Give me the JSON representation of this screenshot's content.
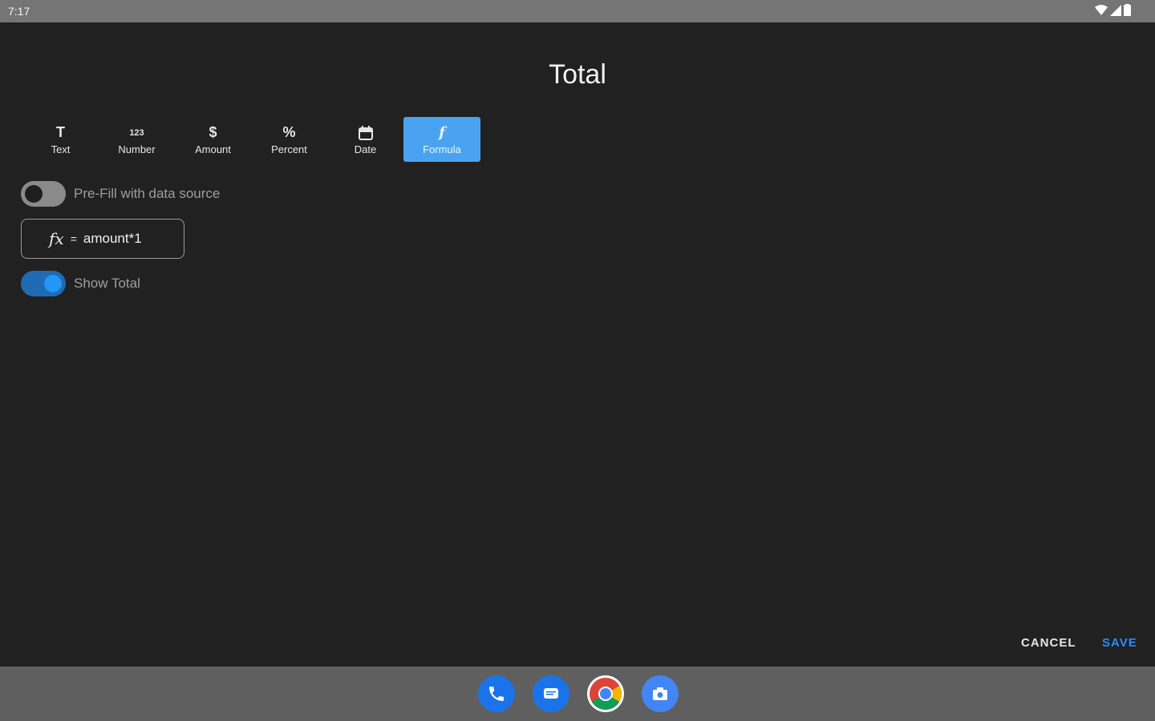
{
  "status_bar": {
    "time": "7:17"
  },
  "dialog": {
    "title": "Total",
    "types": [
      {
        "icon": "text-format-icon",
        "glyph": "T",
        "label": "Text",
        "active": false
      },
      {
        "icon": "number-icon",
        "glyph": "123",
        "label": "Number",
        "active": false
      },
      {
        "icon": "dollar-icon",
        "glyph": "$",
        "label": "Amount",
        "active": false
      },
      {
        "icon": "percent-icon",
        "glyph": "%",
        "label": "Percent",
        "active": false
      },
      {
        "icon": "calendar-icon",
        "glyph": "",
        "label": "Date",
        "active": false
      },
      {
        "icon": "function-icon",
        "glyph": "f",
        "label": "Formula",
        "active": true
      }
    ],
    "prefill_toggle": {
      "label": "Pre-Fill with data source",
      "on": false
    },
    "formula": {
      "fx": "fx",
      "equals": "=",
      "expression": "amount*1"
    },
    "show_total_toggle": {
      "label": "Show Total",
      "on": true
    },
    "actions": {
      "cancel": "CANCEL",
      "save": "SAVE"
    }
  },
  "dock": [
    "phone-icon",
    "messages-icon",
    "chrome-icon",
    "camera-icon"
  ],
  "colors": {
    "accent": "#4aa3f0",
    "save": "#2a8cff",
    "background": "#212121"
  }
}
